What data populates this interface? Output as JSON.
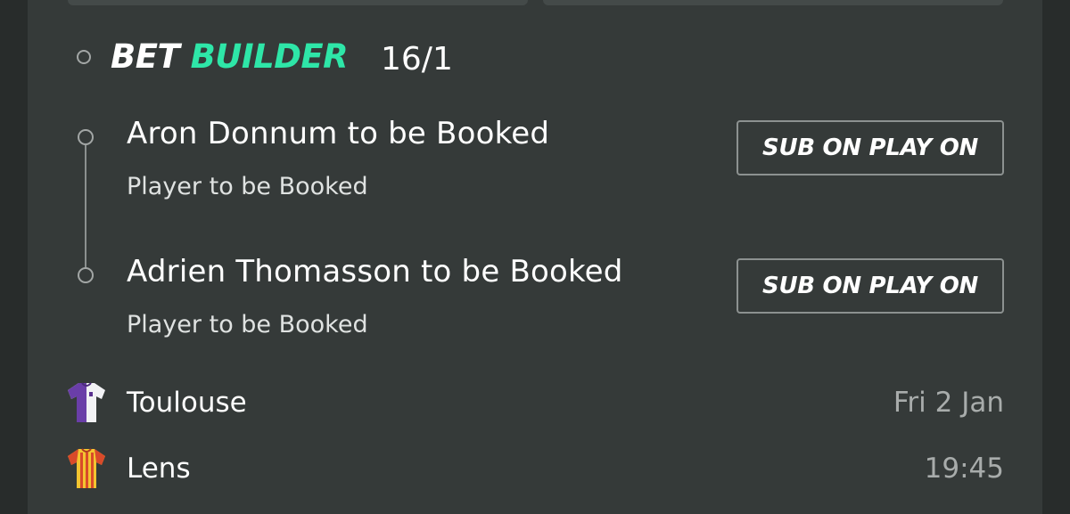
{
  "bet_builder": {
    "label_bet": "BET",
    "label_builder": "BUILDER",
    "odds": "16/1",
    "accent_color": "#2ee6a8"
  },
  "legs": [
    {
      "title": "Aron Donnum to be Booked",
      "market": "Player to be Booked",
      "button_label": "SUB ON PLAY ON"
    },
    {
      "title": "Adrien Thomasson to be Booked",
      "market": "Player to be Booked",
      "button_label": "SUB ON PLAY ON"
    }
  ],
  "match": {
    "home": {
      "name": "Toulouse",
      "kit_icon": "purple-white-shirt-icon",
      "info": "Fri 2 Jan"
    },
    "away": {
      "name": "Lens",
      "kit_icon": "yellow-red-shirt-icon",
      "info": "19:45"
    }
  }
}
